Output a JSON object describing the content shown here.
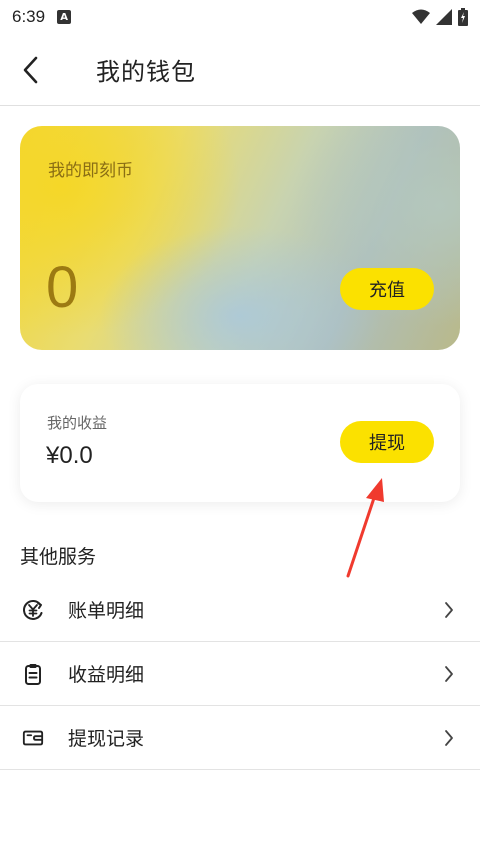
{
  "status_bar": {
    "time": "6:39",
    "notification_letter": "A"
  },
  "header": {
    "title": "我的钱包"
  },
  "coin_card": {
    "label": "我的即刻币",
    "value": "0",
    "button_label": "充值"
  },
  "earnings_card": {
    "label": "我的收益",
    "value": "¥0.0",
    "button_label": "提现"
  },
  "services": {
    "title": "其他服务",
    "items": [
      {
        "label": "账单明细",
        "icon": "yen-circle-icon"
      },
      {
        "label": "收益明细",
        "icon": "clipboard-icon"
      },
      {
        "label": "提现记录",
        "icon": "wallet-icon"
      }
    ]
  },
  "colors": {
    "accent": "#fbe100",
    "annotation_arrow": "#f03a2e",
    "coin_text": "#9c7a12"
  }
}
